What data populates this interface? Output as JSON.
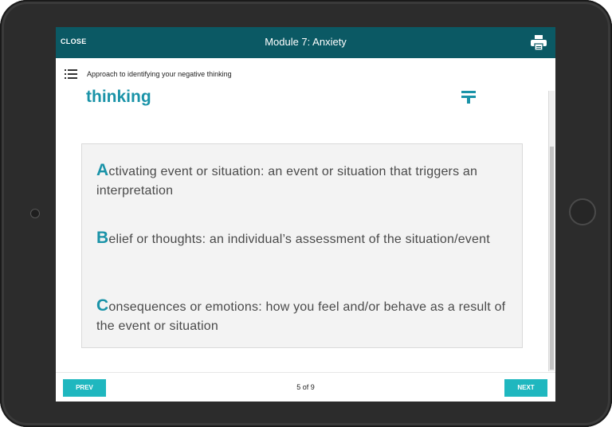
{
  "header": {
    "close_label": "CLOSE",
    "title": "Module 7: Anxiety",
    "print_icon": "printer-icon",
    "background_color": "#0b5964"
  },
  "subheader": {
    "menu_icon": "list-menu-icon",
    "breadcrumb": "Approach to identifying your negative thinking",
    "section_title": "thinking",
    "filter_icon": "filter-icon",
    "accent_color": "#1a93a8"
  },
  "content": {
    "items": [
      {
        "letter": "A",
        "text": "ctivating event or situation: an event or situation that triggers an interpretation"
      },
      {
        "letter": "B",
        "text": "elief or thoughts: an individual’s assessment of the situation/event"
      },
      {
        "letter": "C",
        "text": "onsequences or emotions: how you feel and/or behave as a result of the event or situation"
      }
    ]
  },
  "footer": {
    "prev_label": "PREV",
    "next_label": "NEXT",
    "page_indicator": "5 of 9",
    "button_color": "#1fb7bf"
  }
}
